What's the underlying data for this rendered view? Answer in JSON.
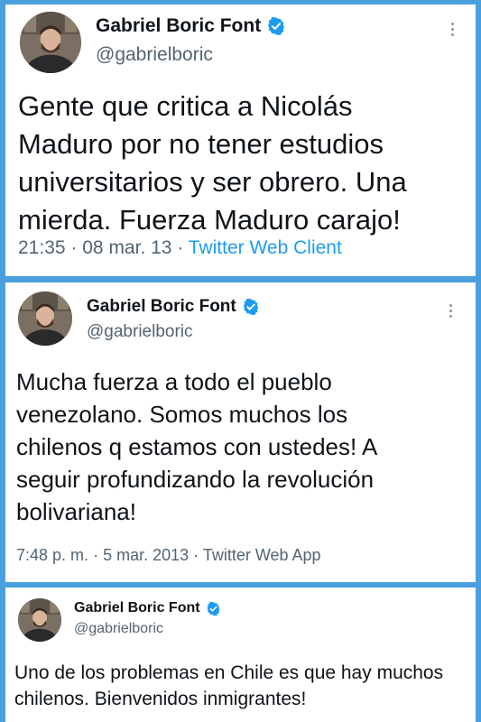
{
  "colors": {
    "background": "#4aa0dc",
    "card": "#ffffff",
    "text": "#0f1419",
    "secondary": "#536471",
    "link": "#1d9bf0",
    "verified": "#1d9bf0"
  },
  "tweets": [
    {
      "author": {
        "name": "Gabriel Boric Font",
        "handle": "@gabrielboric",
        "verified_icon": "verified-badge-icon",
        "avatar_icon": "profile-avatar"
      },
      "text": "Gente que critica a Nicolás\nMaduro por no tener estudios\nuniversitarios y ser obrero. Una\nmierda. Fuerza Maduro carajo!",
      "time": "21:35",
      "date": "08 mar. 13",
      "source": "Twitter Web Client",
      "separator": "·"
    },
    {
      "author": {
        "name": "Gabriel Boric Font",
        "handle": "@gabrielboric",
        "verified_icon": "verified-badge-icon",
        "avatar_icon": "profile-avatar"
      },
      "text": "Mucha fuerza a todo el pueblo\nvenezolano. Somos muchos los\nchilenos q estamos con ustedes! A\nseguir profundizando la revolución\nbolivariana!",
      "time": "7:48 p. m.",
      "date": "5 mar. 2013",
      "source": "Twitter Web App",
      "separator": "·"
    },
    {
      "author": {
        "name": "Gabriel Boric Font",
        "handle": "@gabrielboric",
        "verified_icon": "verified-badge-icon",
        "avatar_icon": "profile-avatar"
      },
      "text": "Uno de los problemas en Chile es que hay muchos\nchilenos. Bienvenidos inmigrantes!"
    }
  ]
}
